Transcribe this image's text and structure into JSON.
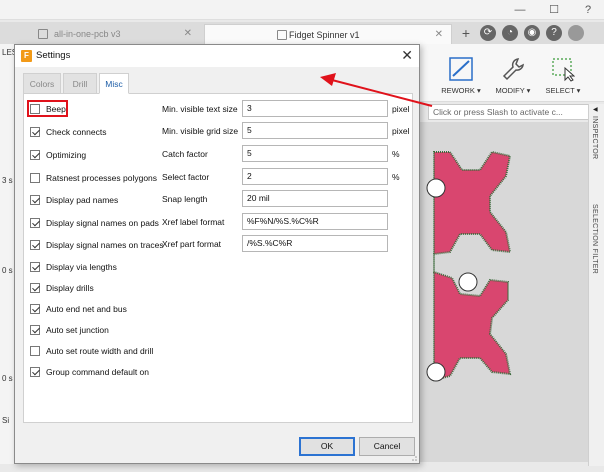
{
  "app": {
    "tabs": [
      {
        "label": "all-in-one-pcb v3"
      },
      {
        "label": "Fidget Spinner v1"
      }
    ],
    "toolbar": {
      "rework_label": "REWORK ▾",
      "modify_label": "MODIFY ▾",
      "select_label": "SELECT ▾"
    },
    "command_placeholder": "Click or press Slash to activate c...",
    "right_panel": {
      "inspector_label": "INSPECTOR",
      "selection_filter_label": "SELECTION FILTER"
    },
    "left_strip_labels": [
      "LES",
      "3 s",
      "0 s",
      "0 s",
      "Si"
    ]
  },
  "dialog": {
    "title": "Settings",
    "tabs": [
      {
        "label": "Colors",
        "active": false
      },
      {
        "label": "Drill",
        "active": false
      },
      {
        "label": "Misc",
        "active": true
      }
    ],
    "checkboxes": [
      {
        "label": "Beep",
        "checked": false,
        "highlighted": true
      },
      {
        "label": "Check connects",
        "checked": true
      },
      {
        "label": "Optimizing",
        "checked": true
      },
      {
        "label": "Ratsnest processes polygons",
        "checked": false
      },
      {
        "label": "Display pad names",
        "checked": true
      },
      {
        "label": "Display signal names on pads",
        "checked": true
      },
      {
        "label": "Display signal names on traces",
        "checked": true
      },
      {
        "label": "Display via lengths",
        "checked": true
      },
      {
        "label": "Display drills",
        "checked": true
      },
      {
        "label": "Auto end net and bus",
        "checked": true
      },
      {
        "label": "Auto set junction",
        "checked": true
      },
      {
        "label": "Auto set route width and drill",
        "checked": false
      },
      {
        "label": "Group command default on",
        "checked": true
      }
    ],
    "fields": [
      {
        "label": "Min. visible text size",
        "value": "3",
        "unit": "pixel"
      },
      {
        "label": "Min. visible grid size",
        "value": "5",
        "unit": "pixel"
      },
      {
        "label": "Catch factor",
        "value": "5",
        "unit": "%"
      },
      {
        "label": "Select factor",
        "value": "2",
        "unit": "%"
      },
      {
        "label": "Snap length",
        "value": "20 mil",
        "unit": ""
      },
      {
        "label": "Xref label format",
        "value": "%F%N/%S.%C%R",
        "unit": ""
      },
      {
        "label": "Xref part format",
        "value": "/%S.%C%R",
        "unit": ""
      }
    ],
    "buttons": {
      "ok": "OK",
      "cancel": "Cancel"
    }
  },
  "colors": {
    "accent": "#1f5fa8",
    "highlight_box": "#e0121b",
    "arrow": "#e0121b",
    "pcb": "#d9466f",
    "pcb_outline": "#3d6b3d"
  }
}
